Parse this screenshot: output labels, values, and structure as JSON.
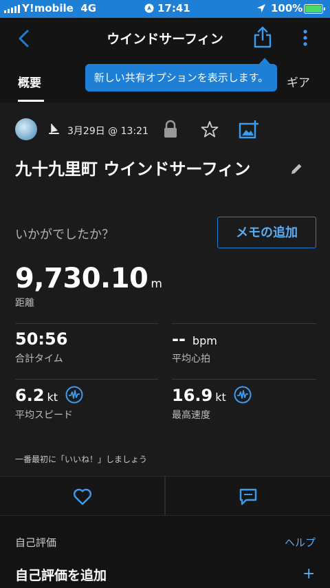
{
  "status_bar": {
    "carrier": "Y!mobile",
    "network": "4G",
    "time": "17:41",
    "battery": "100%"
  },
  "header": {
    "title": "ウインドサーフィン"
  },
  "tabs": {
    "overview": "概要",
    "gear": "ギア"
  },
  "tooltip": {
    "text": "新しい共有オプションを表示します。"
  },
  "activity": {
    "date": "3月29日 @ 13:21",
    "title": "九十九里町 ウインドサーフィン",
    "prompt": "いかがでしたか？",
    "memo_button": "メモの追加"
  },
  "distance": {
    "value": "9,730.10",
    "unit": "m",
    "label": "距離"
  },
  "stats": {
    "total_time": {
      "value": "50:56",
      "label": "合計タイム"
    },
    "avg_hr": {
      "value": "--",
      "unit": "bpm",
      "label": "平均心拍"
    },
    "avg_speed": {
      "value": "6.2",
      "unit": "kt",
      "label": "平均スピード"
    },
    "max_speed": {
      "value": "16.9",
      "unit": "kt",
      "label": "最高速度"
    }
  },
  "social": {
    "likes_text": "一番最初に「いいね！」しましょう"
  },
  "self_evaluation": {
    "title": "自己評価",
    "help": "ヘルプ",
    "add": "自己評価を追加",
    "add_icon": "+"
  },
  "colors": {
    "accent": "#1e7fd6",
    "link": "#59aef5",
    "background": "#1b1b1c"
  }
}
